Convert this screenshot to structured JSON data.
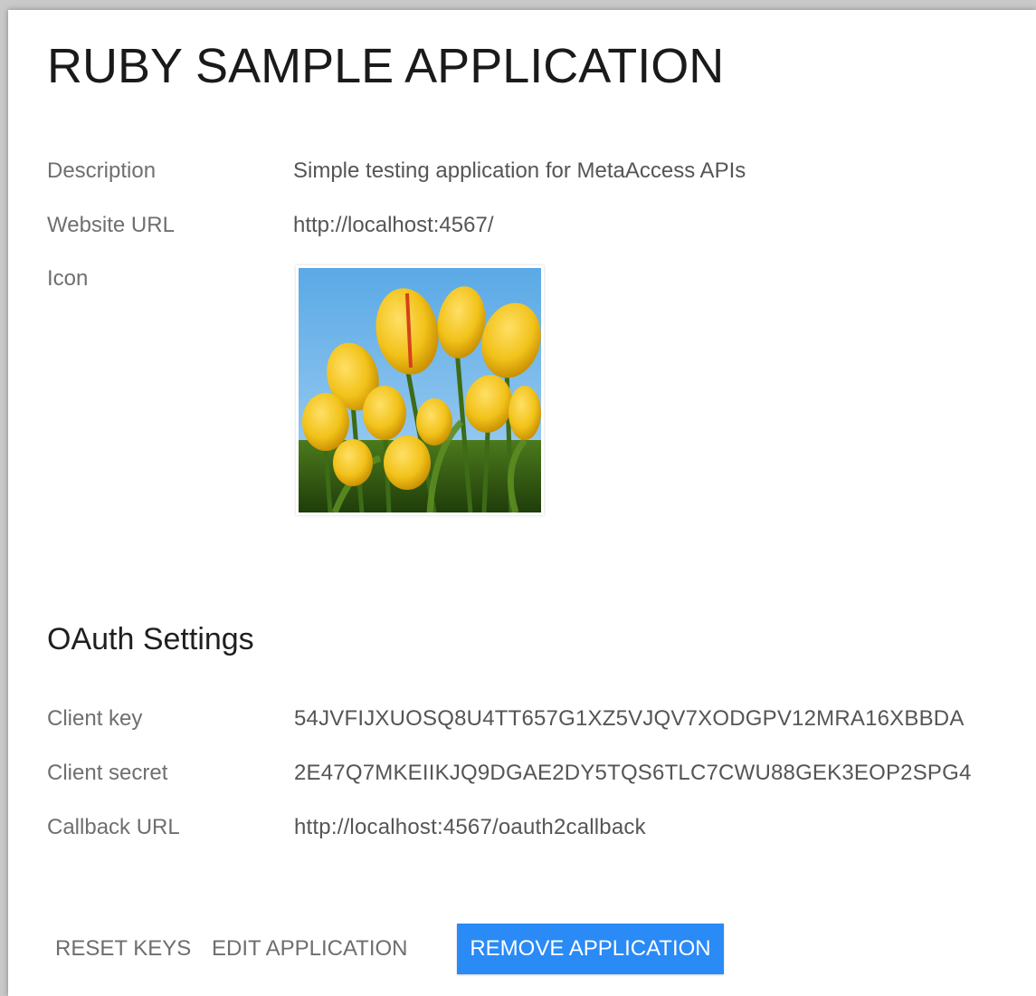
{
  "app": {
    "title": "RUBY SAMPLE APPLICATION"
  },
  "details": {
    "description_label": "Description",
    "description_value": "Simple testing application for MetaAccess APIs",
    "website_label": "Website URL",
    "website_value": "http://localhost:4567/",
    "icon_label": "Icon",
    "icon_image": "tulip-photo"
  },
  "oauth": {
    "heading": "OAuth Settings",
    "client_key_label": "Client key",
    "client_key_value": "54JVFIJXUOSQ8U4TT657G1XZ5VJQV7XODGPV12MRA16XBBDA",
    "client_secret_label": "Client secret",
    "client_secret_value": "2E47Q7MKEIIKJQ9DGAE2DY5TQS6TLC7CWU88GEK3EOP2SPG4",
    "callback_label": "Callback URL",
    "callback_value": "http://localhost:4567/oauth2callback"
  },
  "actions": {
    "reset_keys": "RESET KEYS",
    "edit_application": "EDIT APPLICATION",
    "remove_application": "REMOVE APPLICATION"
  },
  "colors": {
    "primary_button": "#2a8af6",
    "label_text": "#6f6f6f",
    "value_text": "#555555"
  }
}
